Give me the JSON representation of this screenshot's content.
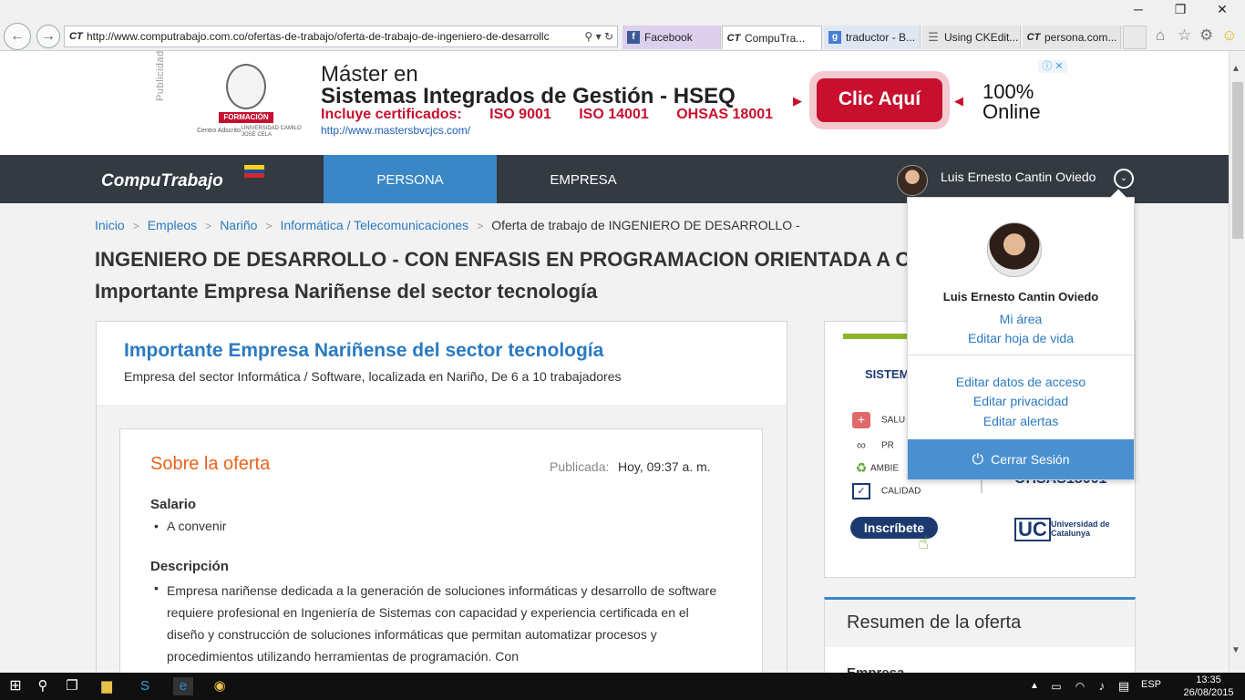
{
  "browser": {
    "url": "http://www.computrabajo.com.co/ofertas-de-trabajo/oferta-de-trabajo-de-ingeniero-de-desarrollc",
    "address_prefix": "CT",
    "tabs": [
      {
        "label": "Facebook",
        "icon": "facebook-icon"
      },
      {
        "label": "CompuTra...",
        "icon": "ct-icon",
        "active": true
      },
      {
        "label": "traductor - B...",
        "icon": "google-icon"
      },
      {
        "label": "Using CKEdit...",
        "icon": "document-icon"
      },
      {
        "label": "persona.com...",
        "icon": "ct-icon"
      }
    ],
    "window_controls": [
      "─",
      "❐",
      "✕"
    ]
  },
  "ad": {
    "publicidad": "Publicidad",
    "formacion": "FORMACIÓN",
    "centro_adscrito": "Centro Adscrito:",
    "universidad": "UNIVERSIDAD CAMILO JOSÉ CELA",
    "line1": "Máster en",
    "line2": "Sistemas Integrados de Gestión - HSEQ",
    "includes": "Incluye certificados:",
    "cert1": "ISO 9001",
    "cert2": "ISO 14001",
    "cert3": "OHSAS 18001",
    "url": "http://www.mastersbvcjcs.com/",
    "button": "Clic Aquí",
    "online_top": "100%",
    "online_bottom": "Online"
  },
  "header": {
    "logo": "CompuTrabajo",
    "nav": [
      {
        "label": "PERSONA",
        "active": true
      },
      {
        "label": "EMPRESA"
      }
    ],
    "user_name": "Luis Ernesto Cantin Oviedo"
  },
  "breadcrumb": {
    "items": [
      "Inicio",
      "Empleos",
      "Nariño",
      "Informática / Telecomunicaciones"
    ],
    "current": "Oferta de trabajo de INGENIERO DE DESARROLLO -",
    "separator": ">"
  },
  "job": {
    "title": "INGENIERO DE DESARROLLO - CON ENFASIS EN PROGRAMACION ORIENTADA A O",
    "company_line": "Importante Empresa Nariñense del sector tecnología"
  },
  "company": {
    "name": "Importante Empresa Nariñense del sector tecnología",
    "desc": "Empresa del sector Informática / Software, localizada en Nariño, De 6 a 10 trabajadores"
  },
  "offer": {
    "title": "Sobre la oferta",
    "published_label": "Publicada:",
    "published_value": "Hoy, 09:37 a. m.",
    "salary_heading": "Salario",
    "salary_value": "A convenir",
    "desc_heading": "Descripción",
    "desc_text": "Empresa nariñense dedicada a la generación de soluciones informáticas y desarrollo de software requiere profesional en Ingeniería de Sistemas con capacidad y experiencia certificada en el diseño y construcción de soluciones informáticas que permitan automatizar procesos y procedimientos utilizando herramientas de programación. Con"
  },
  "side_ad": {
    "heading": "SISTEM",
    "rows": [
      "SALU",
      "PR",
      "AMBIE",
      "CALIDAD"
    ],
    "ohsas": "OHSAS18001",
    "button": "Inscríbete",
    "uc": "UC",
    "uc_name": "Universidad de Catalunya"
  },
  "summary": {
    "title": "Resumen de la oferta",
    "empresa": "Empresa"
  },
  "dropdown": {
    "name": "Luis Ernesto Cantin Oviedo",
    "links1": [
      "Mi área",
      "Editar hoja de vida"
    ],
    "links2": [
      "Editar datos de acceso",
      "Editar privacidad",
      "Editar alertas"
    ],
    "logout": "Cerrar Sesión"
  },
  "taskbar": {
    "lang": "ESP",
    "time": "13:35",
    "date": "26/08/2015"
  },
  "colors": {
    "accent": "#3a87c8",
    "header_bg": "#333a41",
    "link": "#2a7ac0",
    "orange": "#e8641c",
    "ad_red": "#c8102e"
  }
}
